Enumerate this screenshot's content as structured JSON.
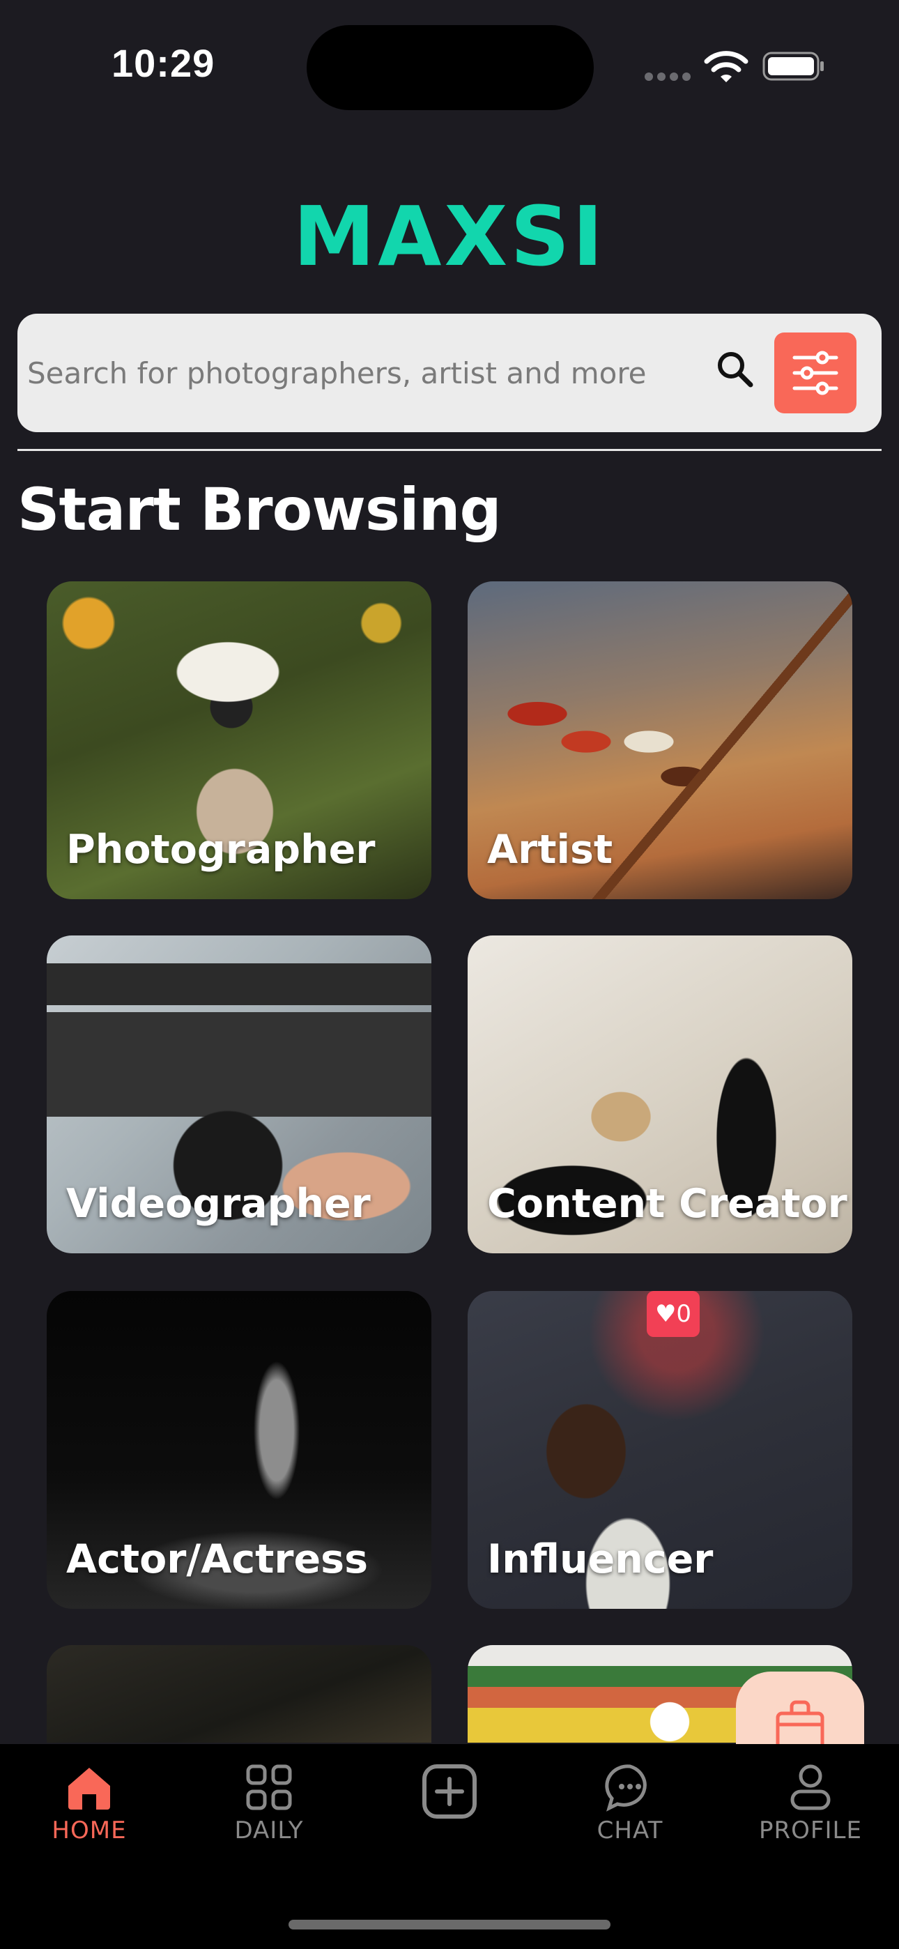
{
  "status": {
    "time": "10:29"
  },
  "brand": {
    "title": "MAXSI",
    "color": "#12d6ad"
  },
  "search": {
    "placeholder": "Search for photographers, artist and more",
    "value": "",
    "search_icon": "search-icon",
    "filter_icon": "sliders-icon"
  },
  "section": {
    "title": "Start Browsing"
  },
  "categories": [
    {
      "label": "Photographer"
    },
    {
      "label": "Artist"
    },
    {
      "label": "Videographer"
    },
    {
      "label": "Content Creator"
    },
    {
      "label": "Actor/Actress"
    },
    {
      "label": "Influencer"
    }
  ],
  "influencer_badge": {
    "count": "0",
    "icon": "heart-icon"
  },
  "tabs": [
    {
      "label": "HOME",
      "icon": "home-icon",
      "active": true
    },
    {
      "label": "DAILY",
      "icon": "grid-icon",
      "active": false
    },
    {
      "label": "",
      "icon": "plus-square-icon",
      "active": false
    },
    {
      "label": "CHAT",
      "icon": "chat-bubble-icon",
      "active": false
    },
    {
      "label": "PROFILE",
      "icon": "user-icon",
      "active": false
    }
  ],
  "colors": {
    "accent": "#f96858",
    "background": "#1c1b21",
    "shop_fab": "#fbd7c7"
  }
}
